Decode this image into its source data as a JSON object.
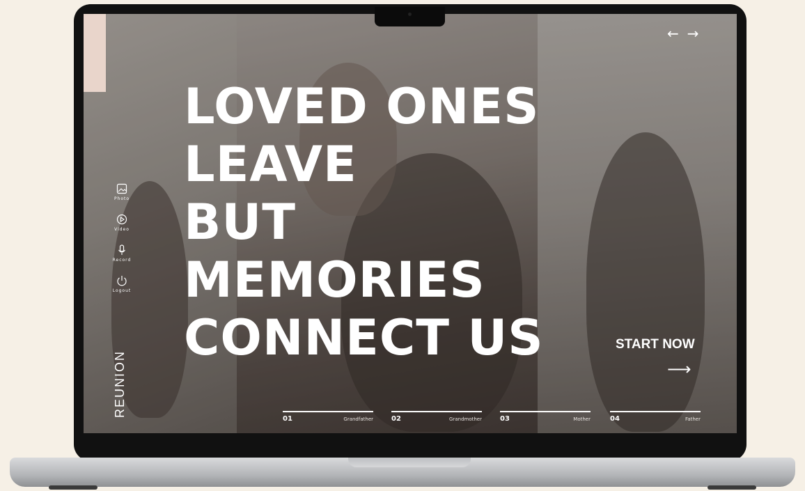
{
  "hero": {
    "lines": [
      "LOVED ONES",
      "LEAVE",
      "BUT",
      "MEMORIES",
      "CONNECT US"
    ]
  },
  "nav": {
    "prev_icon": "arrow-left",
    "next_icon": "arrow-right",
    "prev": "←",
    "next": "→"
  },
  "side_menu": [
    {
      "label": "Photo",
      "icon": "photo-icon"
    },
    {
      "label": "Video",
      "icon": "play-icon"
    },
    {
      "label": "Record",
      "icon": "microphone-icon"
    },
    {
      "label": "Logout",
      "icon": "power-icon"
    }
  ],
  "logo": "REUNION",
  "cta": {
    "label": "START NOW",
    "arrow": "⟶"
  },
  "steps": [
    {
      "num": "01",
      "name": "Grandfather"
    },
    {
      "num": "02",
      "name": "Grandmother"
    },
    {
      "num": "03",
      "name": "Mother"
    },
    {
      "num": "04",
      "name": "Father"
    }
  ],
  "colors": {
    "background": "#f6f0e6",
    "accent": "#e9d5cb",
    "text": "#ffffff"
  }
}
